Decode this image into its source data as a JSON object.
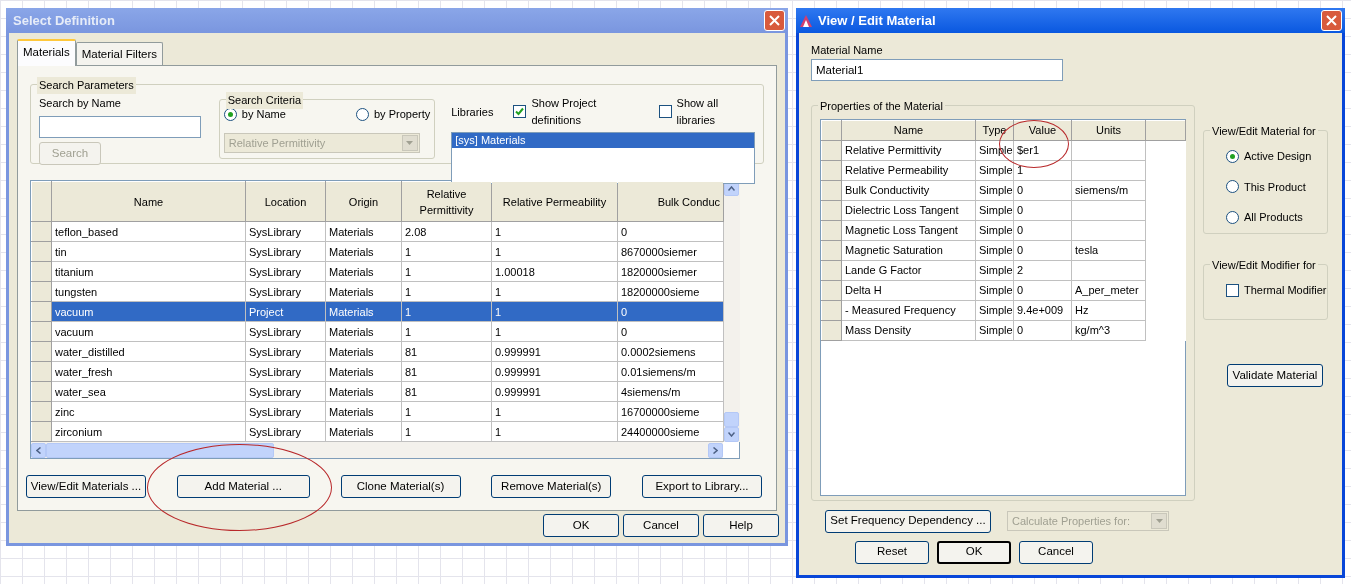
{
  "select_definition": {
    "title": "Select Definition",
    "tabs": [
      {
        "label": "Materials",
        "selected": true
      },
      {
        "label": "Material Filters",
        "selected": false
      }
    ],
    "search_parameters": {
      "title": "Search Parameters",
      "name_label": "Search by Name",
      "search_button": {
        "label": "Search",
        "disabled": true
      }
    },
    "search_criteria": {
      "title": "Search Criteria",
      "options": [
        {
          "label": "by Name",
          "selected": true
        },
        {
          "label": "by Property",
          "selected": false
        }
      ],
      "property_dropdown": {
        "value": "Relative Permittivity",
        "disabled": true
      }
    },
    "libraries": {
      "label": "Libraries",
      "checkboxes": [
        {
          "label": "Show Project definitions",
          "checked": true
        },
        {
          "label": "Show all libraries",
          "checked": false
        }
      ],
      "items": [
        {
          "label": "[sys] Materials",
          "selected": true
        }
      ]
    },
    "table": {
      "columns": [
        "Name",
        "Location",
        "Origin",
        "Relative Permittivity",
        "Relative Permeability",
        "Bulk Conduc"
      ],
      "rows": [
        {
          "cells": [
            "teflon_based",
            "SysLibrary",
            "Materials",
            "2.08",
            "1",
            "0"
          ],
          "selected": false
        },
        {
          "cells": [
            "tin",
            "SysLibrary",
            "Materials",
            "1",
            "1",
            "8670000siemer"
          ],
          "selected": false
        },
        {
          "cells": [
            "titanium",
            "SysLibrary",
            "Materials",
            "1",
            "1.00018",
            "1820000siemer"
          ],
          "selected": false
        },
        {
          "cells": [
            "tungsten",
            "SysLibrary",
            "Materials",
            "1",
            "1",
            "18200000sieme"
          ],
          "selected": false
        },
        {
          "cells": [
            "vacuum",
            "Project",
            "Materials",
            "1",
            "1",
            "0"
          ],
          "selected": true
        },
        {
          "cells": [
            "vacuum",
            "SysLibrary",
            "Materials",
            "1",
            "1",
            "0"
          ],
          "selected": false
        },
        {
          "cells": [
            "water_distilled",
            "SysLibrary",
            "Materials",
            "81",
            "0.999991",
            "0.0002siemens"
          ],
          "selected": false
        },
        {
          "cells": [
            "water_fresh",
            "SysLibrary",
            "Materials",
            "81",
            "0.999991",
            "0.01siemens/m"
          ],
          "selected": false
        },
        {
          "cells": [
            "water_sea",
            "SysLibrary",
            "Materials",
            "81",
            "0.999991",
            "4siemens/m"
          ],
          "selected": false
        },
        {
          "cells": [
            "zinc",
            "SysLibrary",
            "Materials",
            "1",
            "1",
            "16700000sieme"
          ],
          "selected": false
        },
        {
          "cells": [
            "zirconium",
            "SysLibrary",
            "Materials",
            "1",
            "1",
            "24400000sieme"
          ],
          "selected": false
        }
      ]
    },
    "action_buttons": [
      {
        "label": "View/Edit Materials ...",
        "circled": false
      },
      {
        "label": "Add Material ...",
        "circled": true
      },
      {
        "label": "Clone Material(s)",
        "circled": false
      },
      {
        "label": "Remove Material(s)",
        "circled": false
      },
      {
        "label": "Export to Library...",
        "circled": false
      }
    ],
    "footer_buttons": [
      "OK",
      "Cancel",
      "Help"
    ]
  },
  "view_edit_material": {
    "title": "View / Edit Material",
    "name_label": "Material Name",
    "name_value": "Material1",
    "properties": {
      "title": "Properties of the Material",
      "columns": [
        {
          "label": "Name",
          "circled": false
        },
        {
          "label": "Type",
          "circled": false
        },
        {
          "label": "Value",
          "circled": true
        },
        {
          "label": "Units",
          "circled": false
        }
      ],
      "rows": [
        [
          "Relative Permittivity",
          "Simple",
          "$er1"
        ],
        [
          "Relative Permeability",
          "Simple",
          "1"
        ],
        [
          "Bulk Conductivity",
          "Simple",
          "0",
          "siemens/m"
        ],
        [
          "Dielectric Loss Tangent",
          "Simple",
          "0"
        ],
        [
          "Magnetic Loss Tangent",
          "Simple",
          "0"
        ],
        [
          "Magnetic Saturation",
          "Simple",
          "0",
          "tesla"
        ],
        [
          "Lande G Factor",
          "Simple",
          "2"
        ],
        [
          "Delta H",
          "Simple",
          "0",
          "A_per_meter"
        ],
        [
          "-  Measured Frequency",
          "Simple",
          "9.4e+009",
          "Hz"
        ],
        [
          "Mass Density",
          "Simple",
          "0",
          "kg/m^3"
        ]
      ]
    },
    "material_for": {
      "title": "View/Edit Material for",
      "options": [
        {
          "label": "Active Design",
          "selected": true
        },
        {
          "label": "This Product",
          "selected": false
        },
        {
          "label": "All Products",
          "selected": false
        }
      ]
    },
    "modifier_for": {
      "title": "View/Edit Modifier for",
      "checkboxes": [
        {
          "label": "Thermal Modifier",
          "checked": false
        }
      ]
    },
    "validate_button": "Validate Material",
    "frequency_button": "Set Frequency Dependency ...",
    "calculate_dropdown": {
      "value": "Calculate Properties for:",
      "disabled": true
    },
    "footer_buttons": [
      {
        "label": "Reset",
        "default": false
      },
      {
        "label": "OK",
        "default": true
      },
      {
        "label": "Cancel",
        "default": false
      }
    ]
  }
}
